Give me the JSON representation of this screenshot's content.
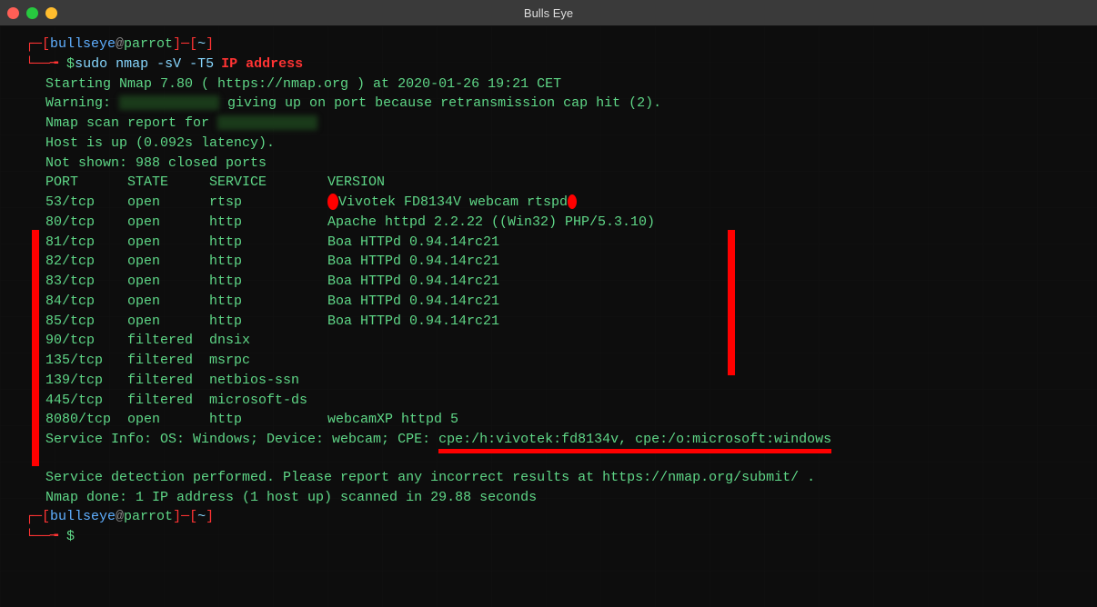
{
  "window": {
    "title": "Bulls Eye"
  },
  "prompt": {
    "user": "bullseye",
    "host": "parrot",
    "cwd": "~",
    "symbol": "$"
  },
  "command": "sudo nmap -sV -T5",
  "ip_label": "IP address",
  "output": {
    "starting": "Starting Nmap 7.80 ( https://nmap.org ) at 2020-01-26 19:21 CET",
    "warning_prefix": "Warning:",
    "warning_suffix": "giving up on port because retransmission cap hit (2).",
    "scan_report_prefix": "Nmap scan report for",
    "host_up": "Host is up (0.092s latency).",
    "not_shown": "Not shown: 988 closed ports",
    "headers": {
      "port": "PORT",
      "state": "STATE",
      "service": "SERVICE",
      "version": "VERSION"
    },
    "rows": [
      {
        "port": "53/tcp",
        "state": "open",
        "service": "rtsp",
        "version": "Vivotek FD8134V webcam rtspd"
      },
      {
        "port": "80/tcp",
        "state": "open",
        "service": "http",
        "version": "Apache httpd 2.2.22 ((Win32) PHP/5.3.10)"
      },
      {
        "port": "81/tcp",
        "state": "open",
        "service": "http",
        "version": "Boa HTTPd 0.94.14rc21"
      },
      {
        "port": "82/tcp",
        "state": "open",
        "service": "http",
        "version": "Boa HTTPd 0.94.14rc21"
      },
      {
        "port": "83/tcp",
        "state": "open",
        "service": "http",
        "version": "Boa HTTPd 0.94.14rc21"
      },
      {
        "port": "84/tcp",
        "state": "open",
        "service": "http",
        "version": "Boa HTTPd 0.94.14rc21"
      },
      {
        "port": "85/tcp",
        "state": "open",
        "service": "http",
        "version": "Boa HTTPd 0.94.14rc21"
      },
      {
        "port": "90/tcp",
        "state": "filtered",
        "service": "dnsix",
        "version": ""
      },
      {
        "port": "135/tcp",
        "state": "filtered",
        "service": "msrpc",
        "version": ""
      },
      {
        "port": "139/tcp",
        "state": "filtered",
        "service": "netbios-ssn",
        "version": ""
      },
      {
        "port": "445/tcp",
        "state": "filtered",
        "service": "microsoft-ds",
        "version": ""
      },
      {
        "port": "8080/tcp",
        "state": "open",
        "service": "http",
        "version": "webcamXP httpd 5"
      }
    ],
    "service_info_prefix": "Service Info: OS: Windows; Device: webcam; CPE: ",
    "service_info_cpe": "cpe:/h:vivotek:fd8134v, cpe:/o:microsoft:windows",
    "detection": "Service detection performed. Please report any incorrect results at https://nmap.org/submit/ .",
    "done": "Nmap done: 1 IP address (1 host up) scanned in 29.88 seconds"
  }
}
